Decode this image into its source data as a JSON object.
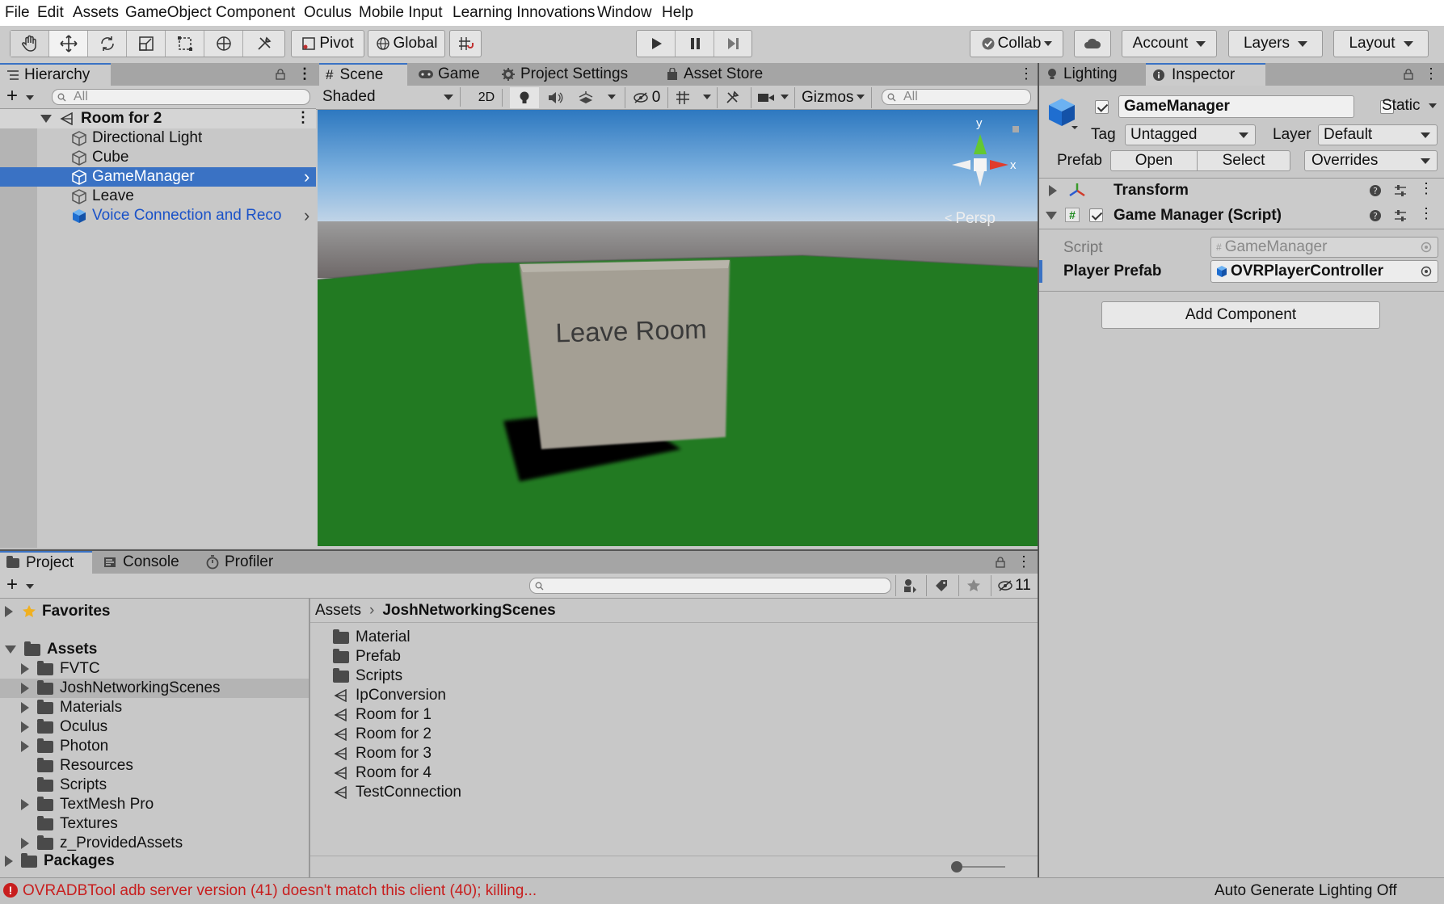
{
  "menu": [
    "File",
    "Edit",
    "Assets",
    "GameObject",
    "Component",
    "Oculus",
    "Mobile Input",
    "Learning Innovations",
    "Window",
    "Help"
  ],
  "toolbar": {
    "pivot": "Pivot",
    "global": "Global",
    "collab": "Collab",
    "account": "Account",
    "layers": "Layers",
    "layout": "Layout"
  },
  "hierarchy": {
    "tab": "Hierarchy",
    "search_placeholder": "All",
    "scene": "Room for 2",
    "items": [
      {
        "label": "Directional Light",
        "selected": false,
        "prefab": false
      },
      {
        "label": "Cube",
        "selected": false,
        "prefab": false
      },
      {
        "label": "GameManager",
        "selected": true,
        "prefab": false
      },
      {
        "label": "Leave",
        "selected": false,
        "prefab": false
      },
      {
        "label": "Voice Connection and Reco",
        "selected": false,
        "prefab": true
      }
    ]
  },
  "scene_view": {
    "tabs": [
      "Scene",
      "Game",
      "Project Settings",
      "Asset Store"
    ],
    "shading": "Shaded",
    "mode_2d": "2D",
    "hidden_count": "0",
    "gizmos": "Gizmos",
    "search_placeholder": "All",
    "gizmo_y": "y",
    "gizmo_x": "x",
    "persp": "Persp",
    "sign_text": "Leave Room"
  },
  "inspector": {
    "tabs": [
      "Lighting",
      "Inspector"
    ],
    "object_name": "GameManager",
    "static_label": "Static",
    "tag_label": "Tag",
    "tag_value": "Untagged",
    "layer_label": "Layer",
    "layer_value": "Default",
    "prefab_label": "Prefab",
    "open": "Open",
    "select": "Select",
    "overrides": "Overrides",
    "transform": "Transform",
    "component": "Game Manager (Script)",
    "script_label": "Script",
    "script_value": "GameManager",
    "player_prefab_label": "Player Prefab",
    "player_prefab_value": "OVRPlayerController",
    "add_component": "Add Component"
  },
  "project": {
    "tabs": [
      "Project",
      "Console",
      "Profiler"
    ],
    "hidden_count": "11",
    "favorites": "Favorites",
    "assets": "Assets",
    "tree": [
      "FVTC",
      "JoshNetworkingScenes",
      "Materials",
      "Oculus",
      "Photon",
      "Resources",
      "Scripts",
      "TextMesh Pro",
      "Textures",
      "z_ProvidedAssets"
    ],
    "packages": "Packages",
    "breadcrumb_root": "Assets",
    "breadcrumb_current": "JoshNetworkingScenes",
    "files": [
      {
        "label": "Material",
        "kind": "folder"
      },
      {
        "label": "Prefab",
        "kind": "folder"
      },
      {
        "label": "Scripts",
        "kind": "folder"
      },
      {
        "label": "IpConversion",
        "kind": "scene"
      },
      {
        "label": "Room for 1",
        "kind": "scene"
      },
      {
        "label": "Room for 2",
        "kind": "scene"
      },
      {
        "label": "Room for 3",
        "kind": "scene"
      },
      {
        "label": "Room for 4",
        "kind": "scene"
      },
      {
        "label": "TestConnection",
        "kind": "scene"
      }
    ]
  },
  "status": {
    "error": "OVRADBTool adb server version (41) doesn't match this client (40); killing...",
    "right": "Auto Generate Lighting Off"
  },
  "colors": {
    "selection": "#3a72c4",
    "error": "#c81e1e",
    "prefab_text": "#1a52c8"
  }
}
